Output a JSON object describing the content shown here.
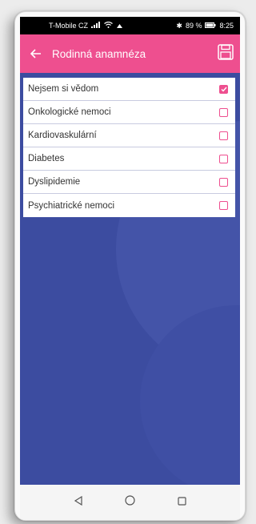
{
  "status_bar": {
    "carrier": "T-Mobile CZ",
    "battery": "89 %",
    "time": "8:25"
  },
  "header": {
    "title": "Rodinná anamnéza"
  },
  "colors": {
    "accent": "#ee4f8f",
    "background": "#3c4ca0",
    "list_bg": "#ffffff"
  },
  "items": [
    {
      "label": "Nejsem si vědom",
      "checked": true
    },
    {
      "label": "Onkologické nemoci",
      "checked": false
    },
    {
      "label": "Kardiovaskulární",
      "checked": false
    },
    {
      "label": "Diabetes",
      "checked": false
    },
    {
      "label": "Dyslipidemie",
      "checked": false
    },
    {
      "label": "Psychiatrické nemoci",
      "checked": false
    }
  ],
  "icons": {
    "back": "arrow-left-icon",
    "save": "floppy-disk-icon",
    "nav_back": "triangle-back-icon",
    "nav_home": "circle-home-icon",
    "nav_recents": "square-recents-icon"
  }
}
